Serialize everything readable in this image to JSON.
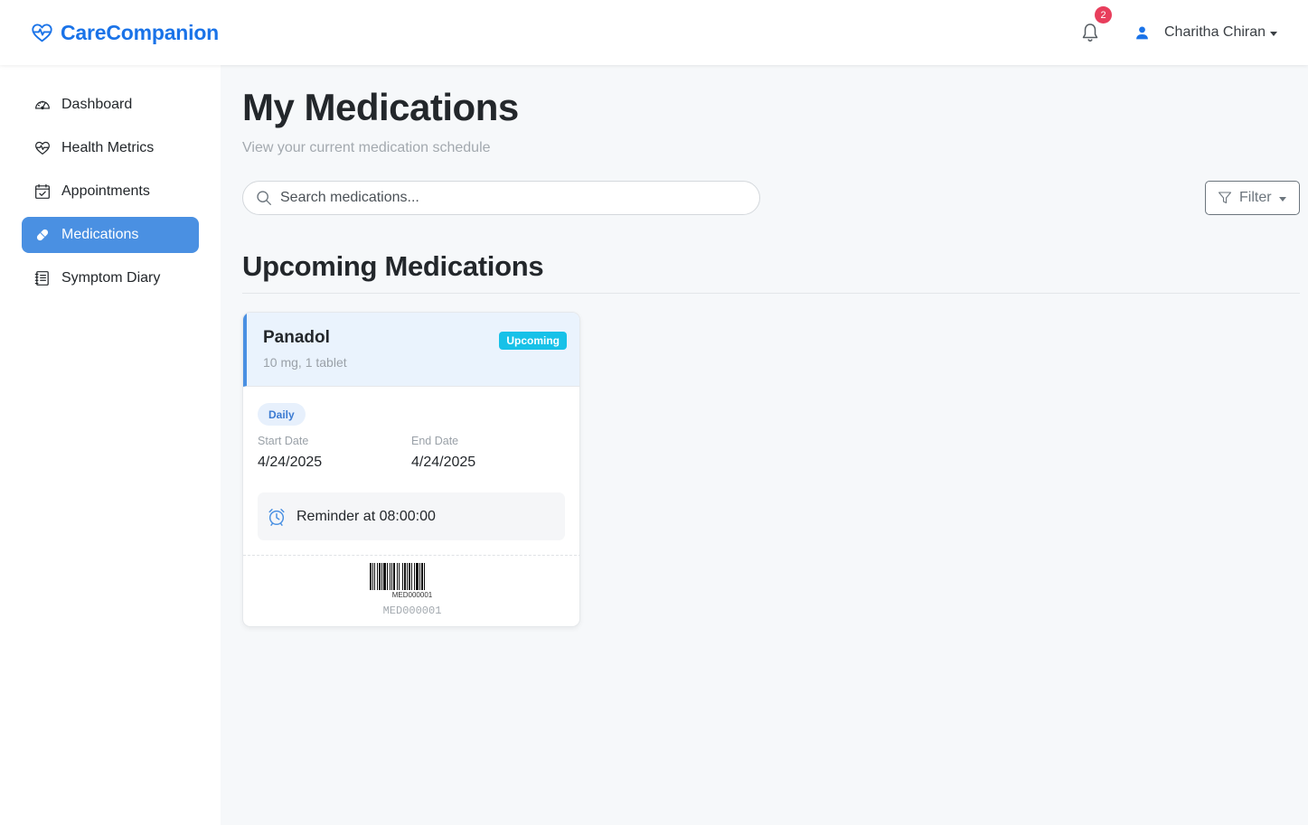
{
  "app": {
    "brand_name": "CareCompanion",
    "brand_color": "#1a73e8"
  },
  "header": {
    "notification_count": "2",
    "user_name": "Charitha Chiran"
  },
  "sidebar": {
    "items": [
      {
        "label": "Dashboard",
        "icon": "gauge-icon",
        "active": false
      },
      {
        "label": "Health Metrics",
        "icon": "heart-pulse-icon",
        "active": false
      },
      {
        "label": "Appointments",
        "icon": "calendar-check-icon",
        "active": false
      },
      {
        "label": "Medications",
        "icon": "capsule-icon",
        "active": true
      },
      {
        "label": "Symptom Diary",
        "icon": "journal-icon",
        "active": false
      }
    ]
  },
  "main": {
    "title": "My Medications",
    "subtitle": "View your current medication schedule",
    "search_placeholder": "Search medications...",
    "filter_label": "Filter",
    "section_title": "Upcoming Medications"
  },
  "medications": [
    {
      "name": "Panadol",
      "dosage": "10 mg, 1 tablet",
      "status": "Upcoming",
      "frequency": "Daily",
      "start_label": "Start Date",
      "start_date": "4/24/2025",
      "end_label": "End Date",
      "end_date": "4/24/2025",
      "reminder": "Reminder at 08:00:00",
      "barcode_text": "MED000001",
      "code": "MED000001"
    }
  ],
  "colors": {
    "accent": "#4a90e2",
    "status_upcoming": "#17c1e8",
    "notification_badge": "#e83e5c"
  }
}
